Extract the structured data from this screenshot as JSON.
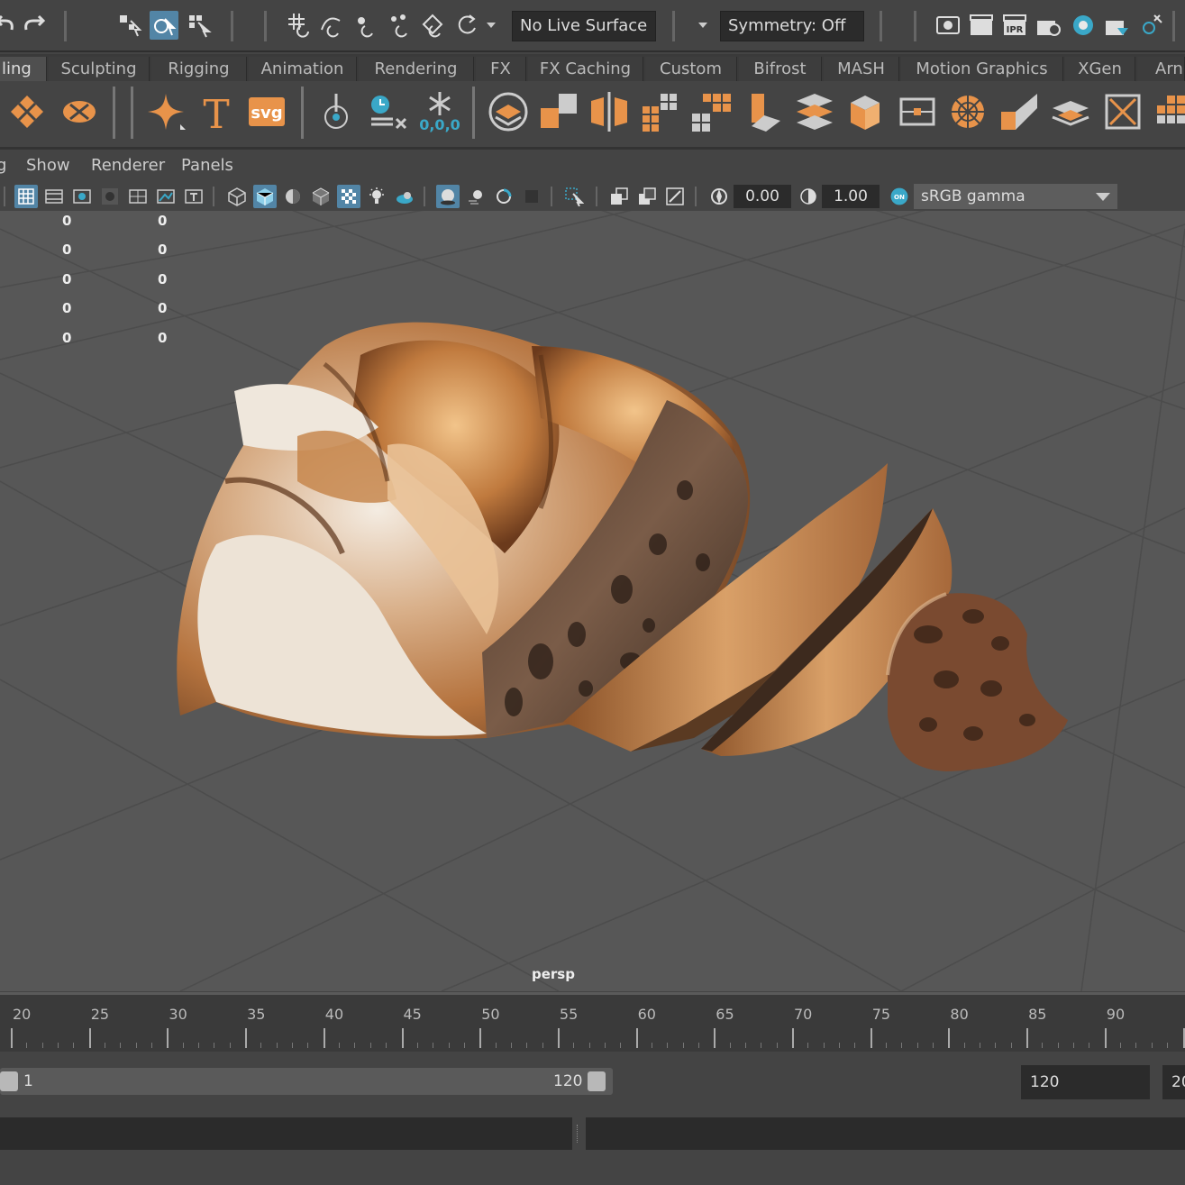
{
  "status_line": {
    "live_surface": "No Live Surface",
    "symmetry": "Symmetry: Off",
    "ipr_label": "IPR"
  },
  "shelf_tabs": [
    {
      "label": "ling",
      "active": true
    },
    {
      "label": "Sculpting"
    },
    {
      "label": "Rigging"
    },
    {
      "label": "Animation"
    },
    {
      "label": "Rendering"
    },
    {
      "label": "FX"
    },
    {
      "label": "FX Caching"
    },
    {
      "label": "Custom"
    },
    {
      "label": "Bifrost"
    },
    {
      "label": "MASH"
    },
    {
      "label": "Motion Graphics"
    },
    {
      "label": "XGen"
    },
    {
      "label": "Arn"
    }
  ],
  "shelf": {
    "text_tool": "T",
    "svg_tool": "svg",
    "origin_label": "0,0,0"
  },
  "panel_menu": [
    "g",
    "Show",
    "Renderer",
    "Panels"
  ],
  "panel_toolbar": {
    "exposure": "0.00",
    "gamma": "1.00",
    "color_mgmt_badge": "ON",
    "color_space": "sRGB gamma"
  },
  "viewport": {
    "hud_rows": [
      [
        "0",
        "0"
      ],
      [
        "0",
        "0"
      ],
      [
        "0",
        "0"
      ],
      [
        "0",
        "0"
      ],
      [
        "0",
        "0"
      ]
    ],
    "camera": "persp"
  },
  "time_slider": {
    "ticks": [
      "20",
      "25",
      "30",
      "35",
      "40",
      "45",
      "50",
      "55",
      "60",
      "65",
      "70",
      "75",
      "80",
      "85",
      "90"
    ]
  },
  "range_slider": {
    "start": "1",
    "end": "120",
    "end_field": "120",
    "anim_end_field": "20"
  },
  "colors": {
    "accent": "#5285a6",
    "shelf_icon": "#e8934a",
    "viewport_bg": "#575757",
    "grid": "#4a4a4a"
  }
}
